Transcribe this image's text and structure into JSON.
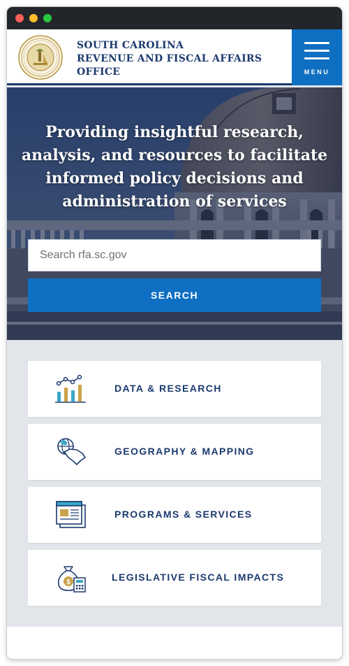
{
  "window": {
    "controls": [
      {
        "name": "close",
        "color": "#ff5f57"
      },
      {
        "name": "minimize",
        "color": "#febc2e"
      },
      {
        "name": "maximize",
        "color": "#28c840"
      }
    ]
  },
  "header": {
    "title_lines": [
      "SOUTH CAROLINA",
      "REVENUE AND FISCAL AFFAIRS",
      "OFFICE"
    ],
    "logo_icon": "state-seal-icon",
    "menu_label": "MENU"
  },
  "hero": {
    "heading": "Providing insightful research, analysis, and resources to facilitate informed policy decisions and administration of services",
    "search_placeholder": "Search rfa.sc.gov",
    "search_button": "SEARCH"
  },
  "cards": [
    {
      "label": "DATA & RESEARCH",
      "icon": "chart-icon"
    },
    {
      "label": "GEOGRAPHY & MAPPING",
      "icon": "globe-map-icon"
    },
    {
      "label": "PROGRAMS & SERVICES",
      "icon": "document-icon"
    },
    {
      "label": "LEGISLATIVE FISCAL IMPACTS",
      "icon": "money-bag-calculator-icon"
    }
  ],
  "colors": {
    "brand_navy": "#1c3a6e",
    "brand_blue": "#0f6fc2",
    "panel_gray": "#e2e6eb",
    "icon_gold": "#c9a24b",
    "icon_teal": "#3aa7c9"
  }
}
